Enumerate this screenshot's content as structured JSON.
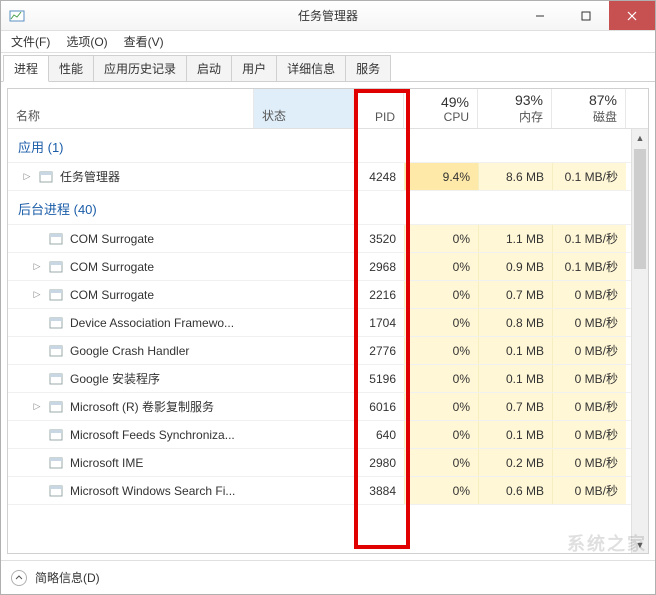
{
  "window": {
    "title": "任务管理器"
  },
  "menubar": [
    {
      "label": "文件(F)"
    },
    {
      "label": "选项(O)"
    },
    {
      "label": "查看(V)"
    }
  ],
  "tabs": [
    {
      "label": "进程",
      "active": true
    },
    {
      "label": "性能"
    },
    {
      "label": "应用历史记录"
    },
    {
      "label": "启动"
    },
    {
      "label": "用户"
    },
    {
      "label": "详细信息"
    },
    {
      "label": "服务"
    }
  ],
  "columns": {
    "name": "名称",
    "status": "状态",
    "pid": "PID",
    "cpu": {
      "pct": "49%",
      "label": "CPU"
    },
    "mem": {
      "pct": "93%",
      "label": "内存"
    },
    "disk": {
      "pct": "87%",
      "label": "磁盘"
    }
  },
  "groups": {
    "apps": {
      "title": "应用 (1)"
    },
    "bg": {
      "title": "后台进程 (40)"
    }
  },
  "processes": {
    "apps": [
      {
        "name": "任务管理器",
        "pid": "4248",
        "cpu": "9.4%",
        "mem": "8.6 MB",
        "disk": "0.1 MB/秒",
        "expandable": true,
        "cpu_hi": true
      }
    ],
    "bg": [
      {
        "name": "COM Surrogate",
        "pid": "3520",
        "cpu": "0%",
        "mem": "1.1 MB",
        "disk": "0.1 MB/秒",
        "expandable": false
      },
      {
        "name": "COM Surrogate",
        "pid": "2968",
        "cpu": "0%",
        "mem": "0.9 MB",
        "disk": "0.1 MB/秒",
        "expandable": true
      },
      {
        "name": "COM Surrogate",
        "pid": "2216",
        "cpu": "0%",
        "mem": "0.7 MB",
        "disk": "0 MB/秒",
        "expandable": true
      },
      {
        "name": "Device Association Framewo...",
        "pid": "1704",
        "cpu": "0%",
        "mem": "0.8 MB",
        "disk": "0 MB/秒",
        "expandable": false
      },
      {
        "name": "Google Crash Handler",
        "pid": "2776",
        "cpu": "0%",
        "mem": "0.1 MB",
        "disk": "0 MB/秒",
        "expandable": false
      },
      {
        "name": "Google 安装程序",
        "pid": "5196",
        "cpu": "0%",
        "mem": "0.1 MB",
        "disk": "0 MB/秒",
        "expandable": false
      },
      {
        "name": "Microsoft (R) 卷影复制服务",
        "pid": "6016",
        "cpu": "0%",
        "mem": "0.7 MB",
        "disk": "0 MB/秒",
        "expandable": true
      },
      {
        "name": "Microsoft Feeds Synchroniza...",
        "pid": "640",
        "cpu": "0%",
        "mem": "0.1 MB",
        "disk": "0 MB/秒",
        "expandable": false
      },
      {
        "name": "Microsoft IME",
        "pid": "2980",
        "cpu": "0%",
        "mem": "0.2 MB",
        "disk": "0 MB/秒",
        "expandable": false
      },
      {
        "name": "Microsoft Windows Search Fi...",
        "pid": "3884",
        "cpu": "0%",
        "mem": "0.6 MB",
        "disk": "0 MB/秒",
        "expandable": false
      }
    ]
  },
  "footer": {
    "label": "简略信息(D)"
  }
}
